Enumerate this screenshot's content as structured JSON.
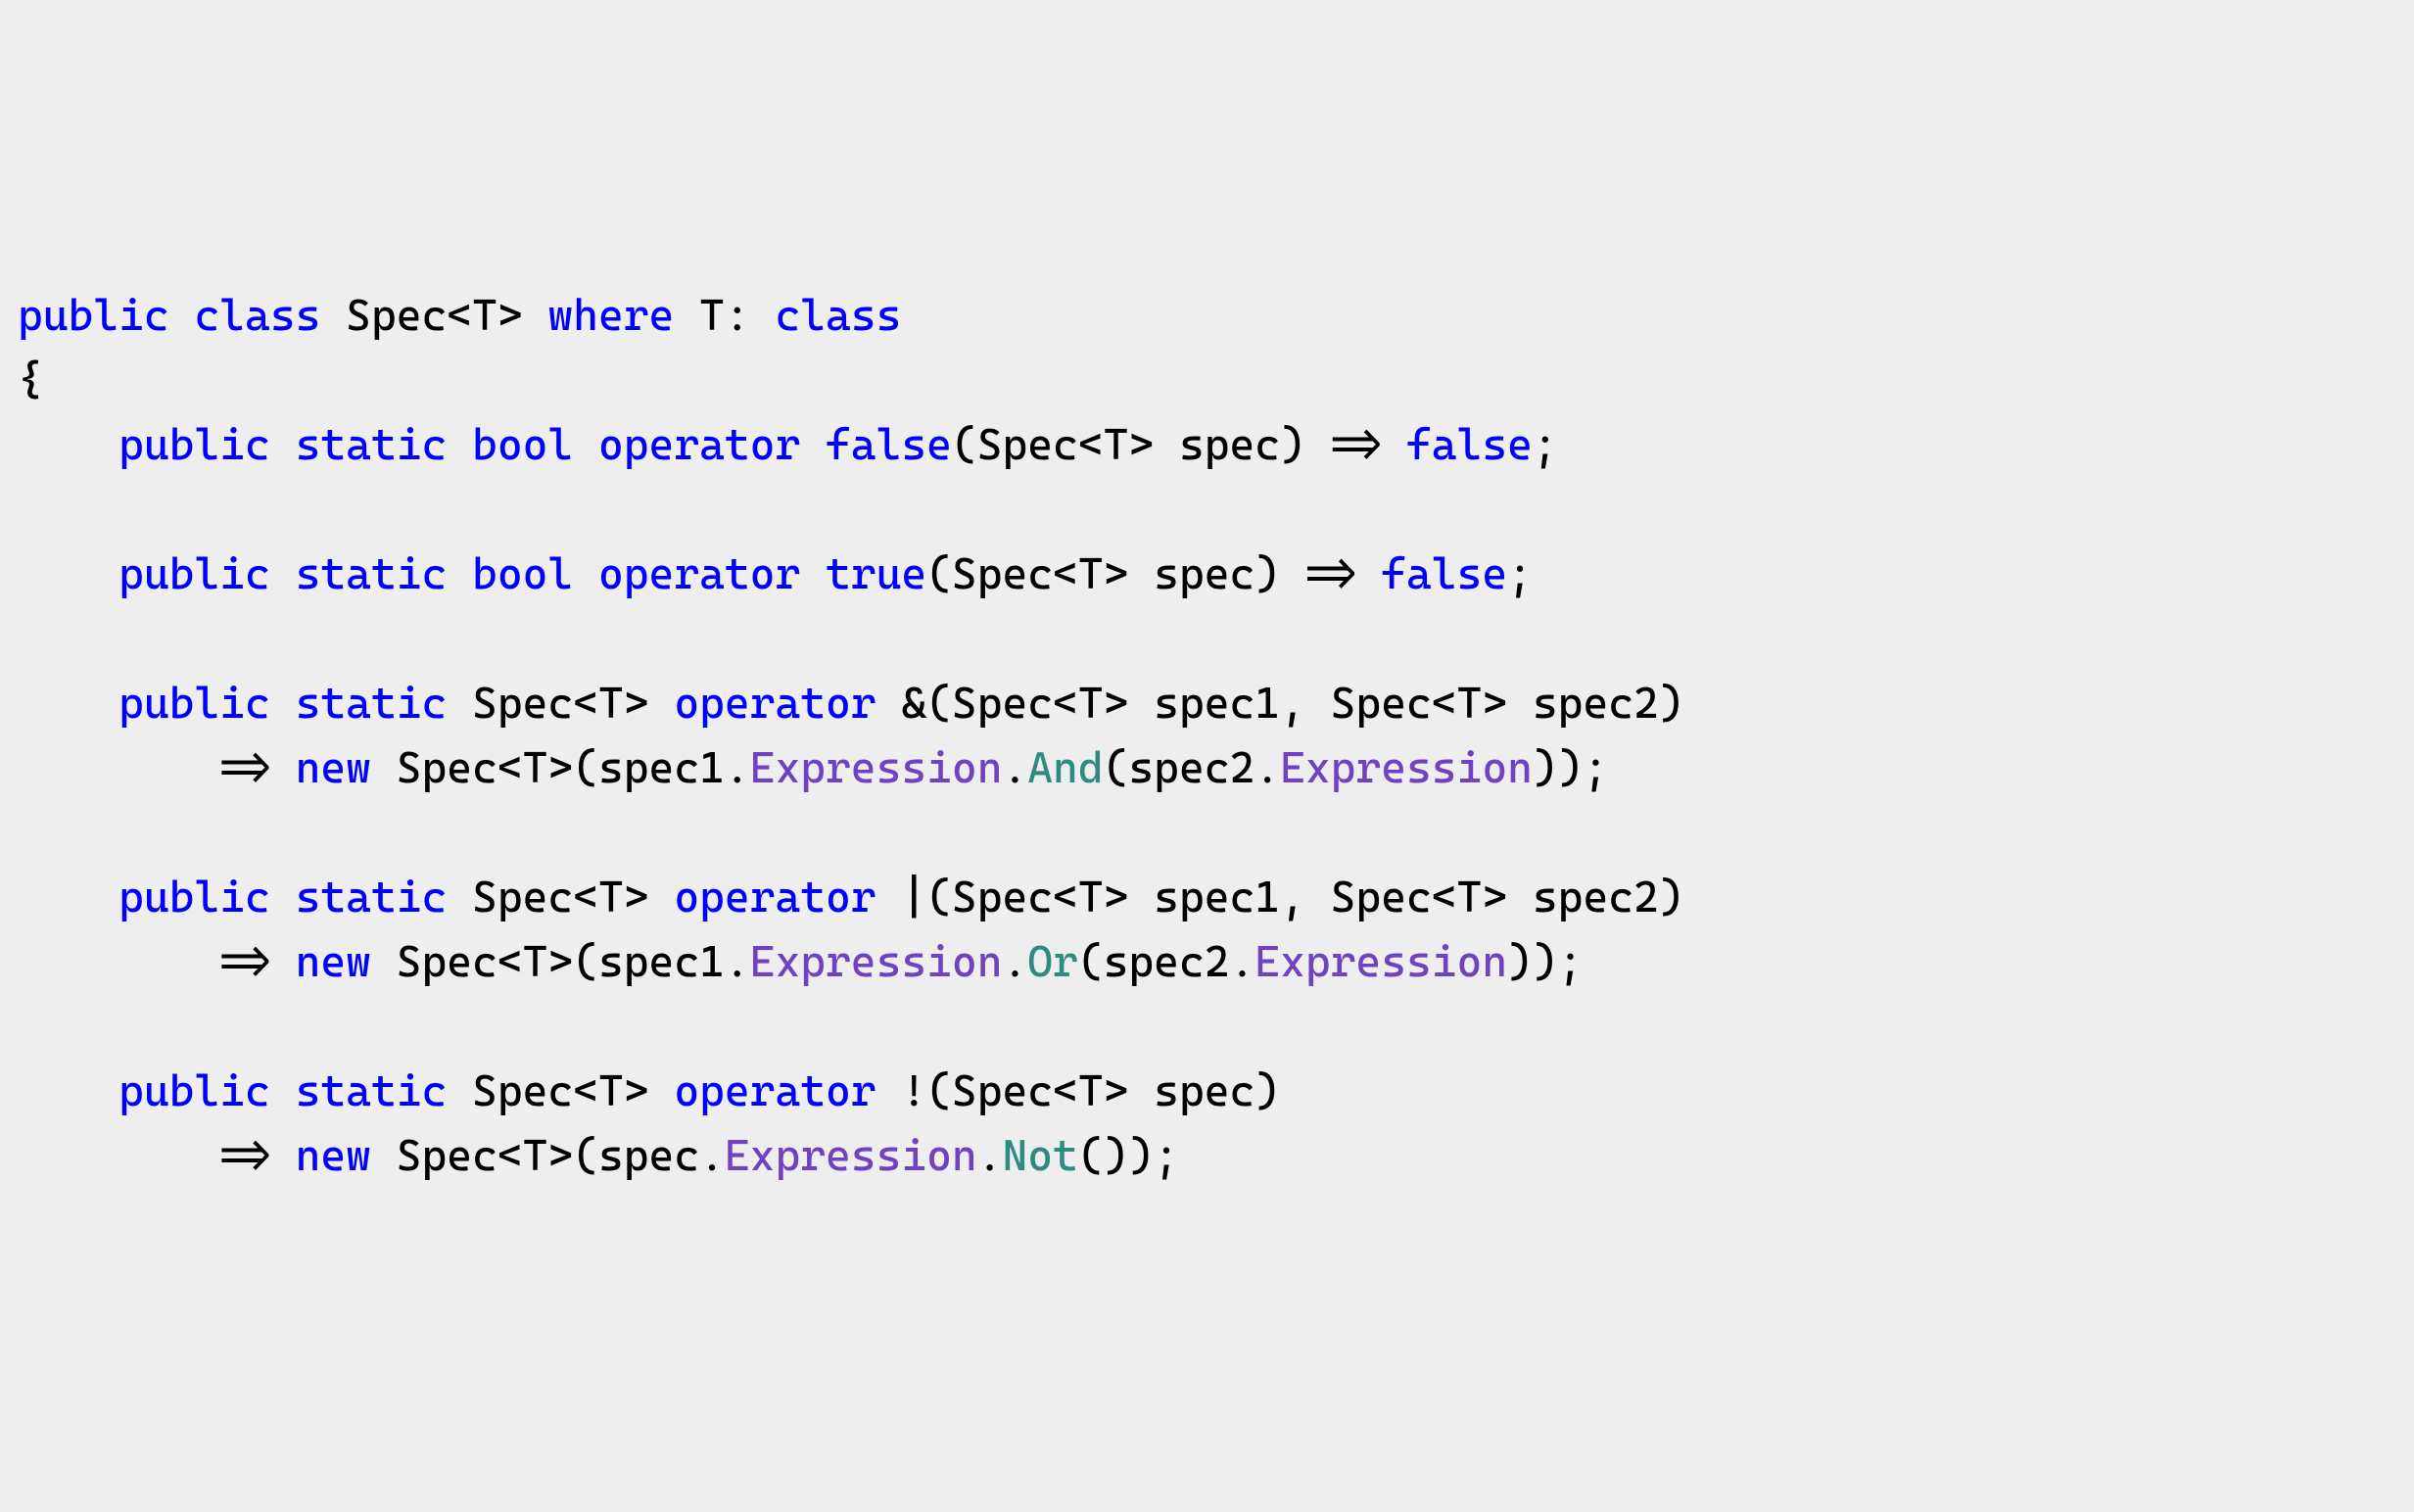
{
  "code": {
    "line1": {
      "kw_public": "public",
      "kw_class": "class",
      "class_name": "Spec",
      "lt1": "<",
      "tparam1": "T",
      "gt1": ">",
      "sp1": " ",
      "kw_where": "where",
      "sp2": " ",
      "tparam2": "T",
      "colon_sp": ": ",
      "kw_class2": "class"
    },
    "open_brace": "{",
    "op_false": {
      "indent": "    ",
      "kw_public": "public",
      "sp1": " ",
      "kw_static": "static",
      "sp2": " ",
      "kw_bool": "bool",
      "sp3": " ",
      "kw_operator": "operator",
      "sp4": " ",
      "kw_false": "false",
      "lparen": "(",
      "spec": "Spec",
      "lt": "<",
      "t": "T",
      "gt": ">",
      "sp5": " ",
      "param": "spec",
      "rparen": ")",
      "arrow": " => ",
      "kw_false2": "false",
      "semi": ";"
    },
    "op_true": {
      "indent": "    ",
      "kw_public": "public",
      "sp1": " ",
      "kw_static": "static",
      "sp2": " ",
      "kw_bool": "bool",
      "sp3": " ",
      "kw_operator": "operator",
      "sp4": " ",
      "kw_true": "true",
      "lparen": "(",
      "spec": "Spec",
      "lt": "<",
      "t": "T",
      "gt": ">",
      "sp5": " ",
      "param": "spec",
      "rparen": ")",
      "arrow": " => ",
      "kw_false": "false",
      "semi": ";"
    },
    "op_and": {
      "line1": {
        "indent": "    ",
        "kw_public": "public",
        "sp1": " ",
        "kw_static": "static",
        "sp2": " ",
        "spec1": "Spec",
        "lt1": "<",
        "t1": "T",
        "gt1": ">",
        "sp3": " ",
        "kw_operator": "operator",
        "sp4": " ",
        "amp": "&",
        "lparen": "(",
        "spec2": "Spec",
        "lt2": "<",
        "t2": "T",
        "gt2": ">",
        "sp5": " ",
        "p1": "spec1",
        "comma": ", ",
        "spec3": "Spec",
        "lt3": "<",
        "t3": "T",
        "gt3": ">",
        "sp6": " ",
        "p2": "spec2",
        "rparen": ")"
      },
      "line2": {
        "indent": "        ",
        "arrow": "=> ",
        "kw_new": "new",
        "sp1": " ",
        "spec": "Spec",
        "lt": "<",
        "t": "T",
        "gt": ">",
        "lparen": "(",
        "p1": "spec1",
        "dot1": ".",
        "expr1": "Expression",
        "dot2": ".",
        "method": "And",
        "lparen2": "(",
        "p2": "spec2",
        "dot3": ".",
        "expr2": "Expression",
        "rparen2": ")",
        "rparen": ")",
        "semi": ";"
      }
    },
    "op_or": {
      "line1": {
        "indent": "    ",
        "kw_public": "public",
        "sp1": " ",
        "kw_static": "static",
        "sp2": " ",
        "spec1": "Spec",
        "lt1": "<",
        "t1": "T",
        "gt1": ">",
        "sp3": " ",
        "kw_operator": "operator",
        "sp4": " ",
        "pipe": "|",
        "lparen": "(",
        "spec2": "Spec",
        "lt2": "<",
        "t2": "T",
        "gt2": ">",
        "sp5": " ",
        "p1": "spec1",
        "comma": ", ",
        "spec3": "Spec",
        "lt3": "<",
        "t3": "T",
        "gt3": ">",
        "sp6": " ",
        "p2": "spec2",
        "rparen": ")"
      },
      "line2": {
        "indent": "        ",
        "arrow": "=> ",
        "kw_new": "new",
        "sp1": " ",
        "spec": "Spec",
        "lt": "<",
        "t": "T",
        "gt": ">",
        "lparen": "(",
        "p1": "spec1",
        "dot1": ".",
        "expr1": "Expression",
        "dot2": ".",
        "method": "Or",
        "lparen2": "(",
        "p2": "spec2",
        "dot3": ".",
        "expr2": "Expression",
        "rparen2": ")",
        "rparen": ")",
        "semi": ";"
      }
    },
    "op_not": {
      "line1": {
        "indent": "    ",
        "kw_public": "public",
        "sp1": " ",
        "kw_static": "static",
        "sp2": " ",
        "spec1": "Spec",
        "lt1": "<",
        "t1": "T",
        "gt1": ">",
        "sp3": " ",
        "kw_operator": "operator",
        "sp4": " ",
        "bang": "!",
        "lparen": "(",
        "spec2": "Spec",
        "lt2": "<",
        "t2": "T",
        "gt2": ">",
        "sp5": " ",
        "p1": "spec",
        "rparen": ")"
      },
      "line2": {
        "indent": "        ",
        "arrow": "=> ",
        "kw_new": "new",
        "sp1": " ",
        "spec": "Spec",
        "lt": "<",
        "t": "T",
        "gt": ">",
        "lparen": "(",
        "p1": "spec",
        "dot1": ".",
        "expr1": "Expression",
        "dot2": ".",
        "method": "Not",
        "lparen2": "(",
        "rparen2": ")",
        "rparen": ")",
        "semi": ";"
      }
    }
  }
}
